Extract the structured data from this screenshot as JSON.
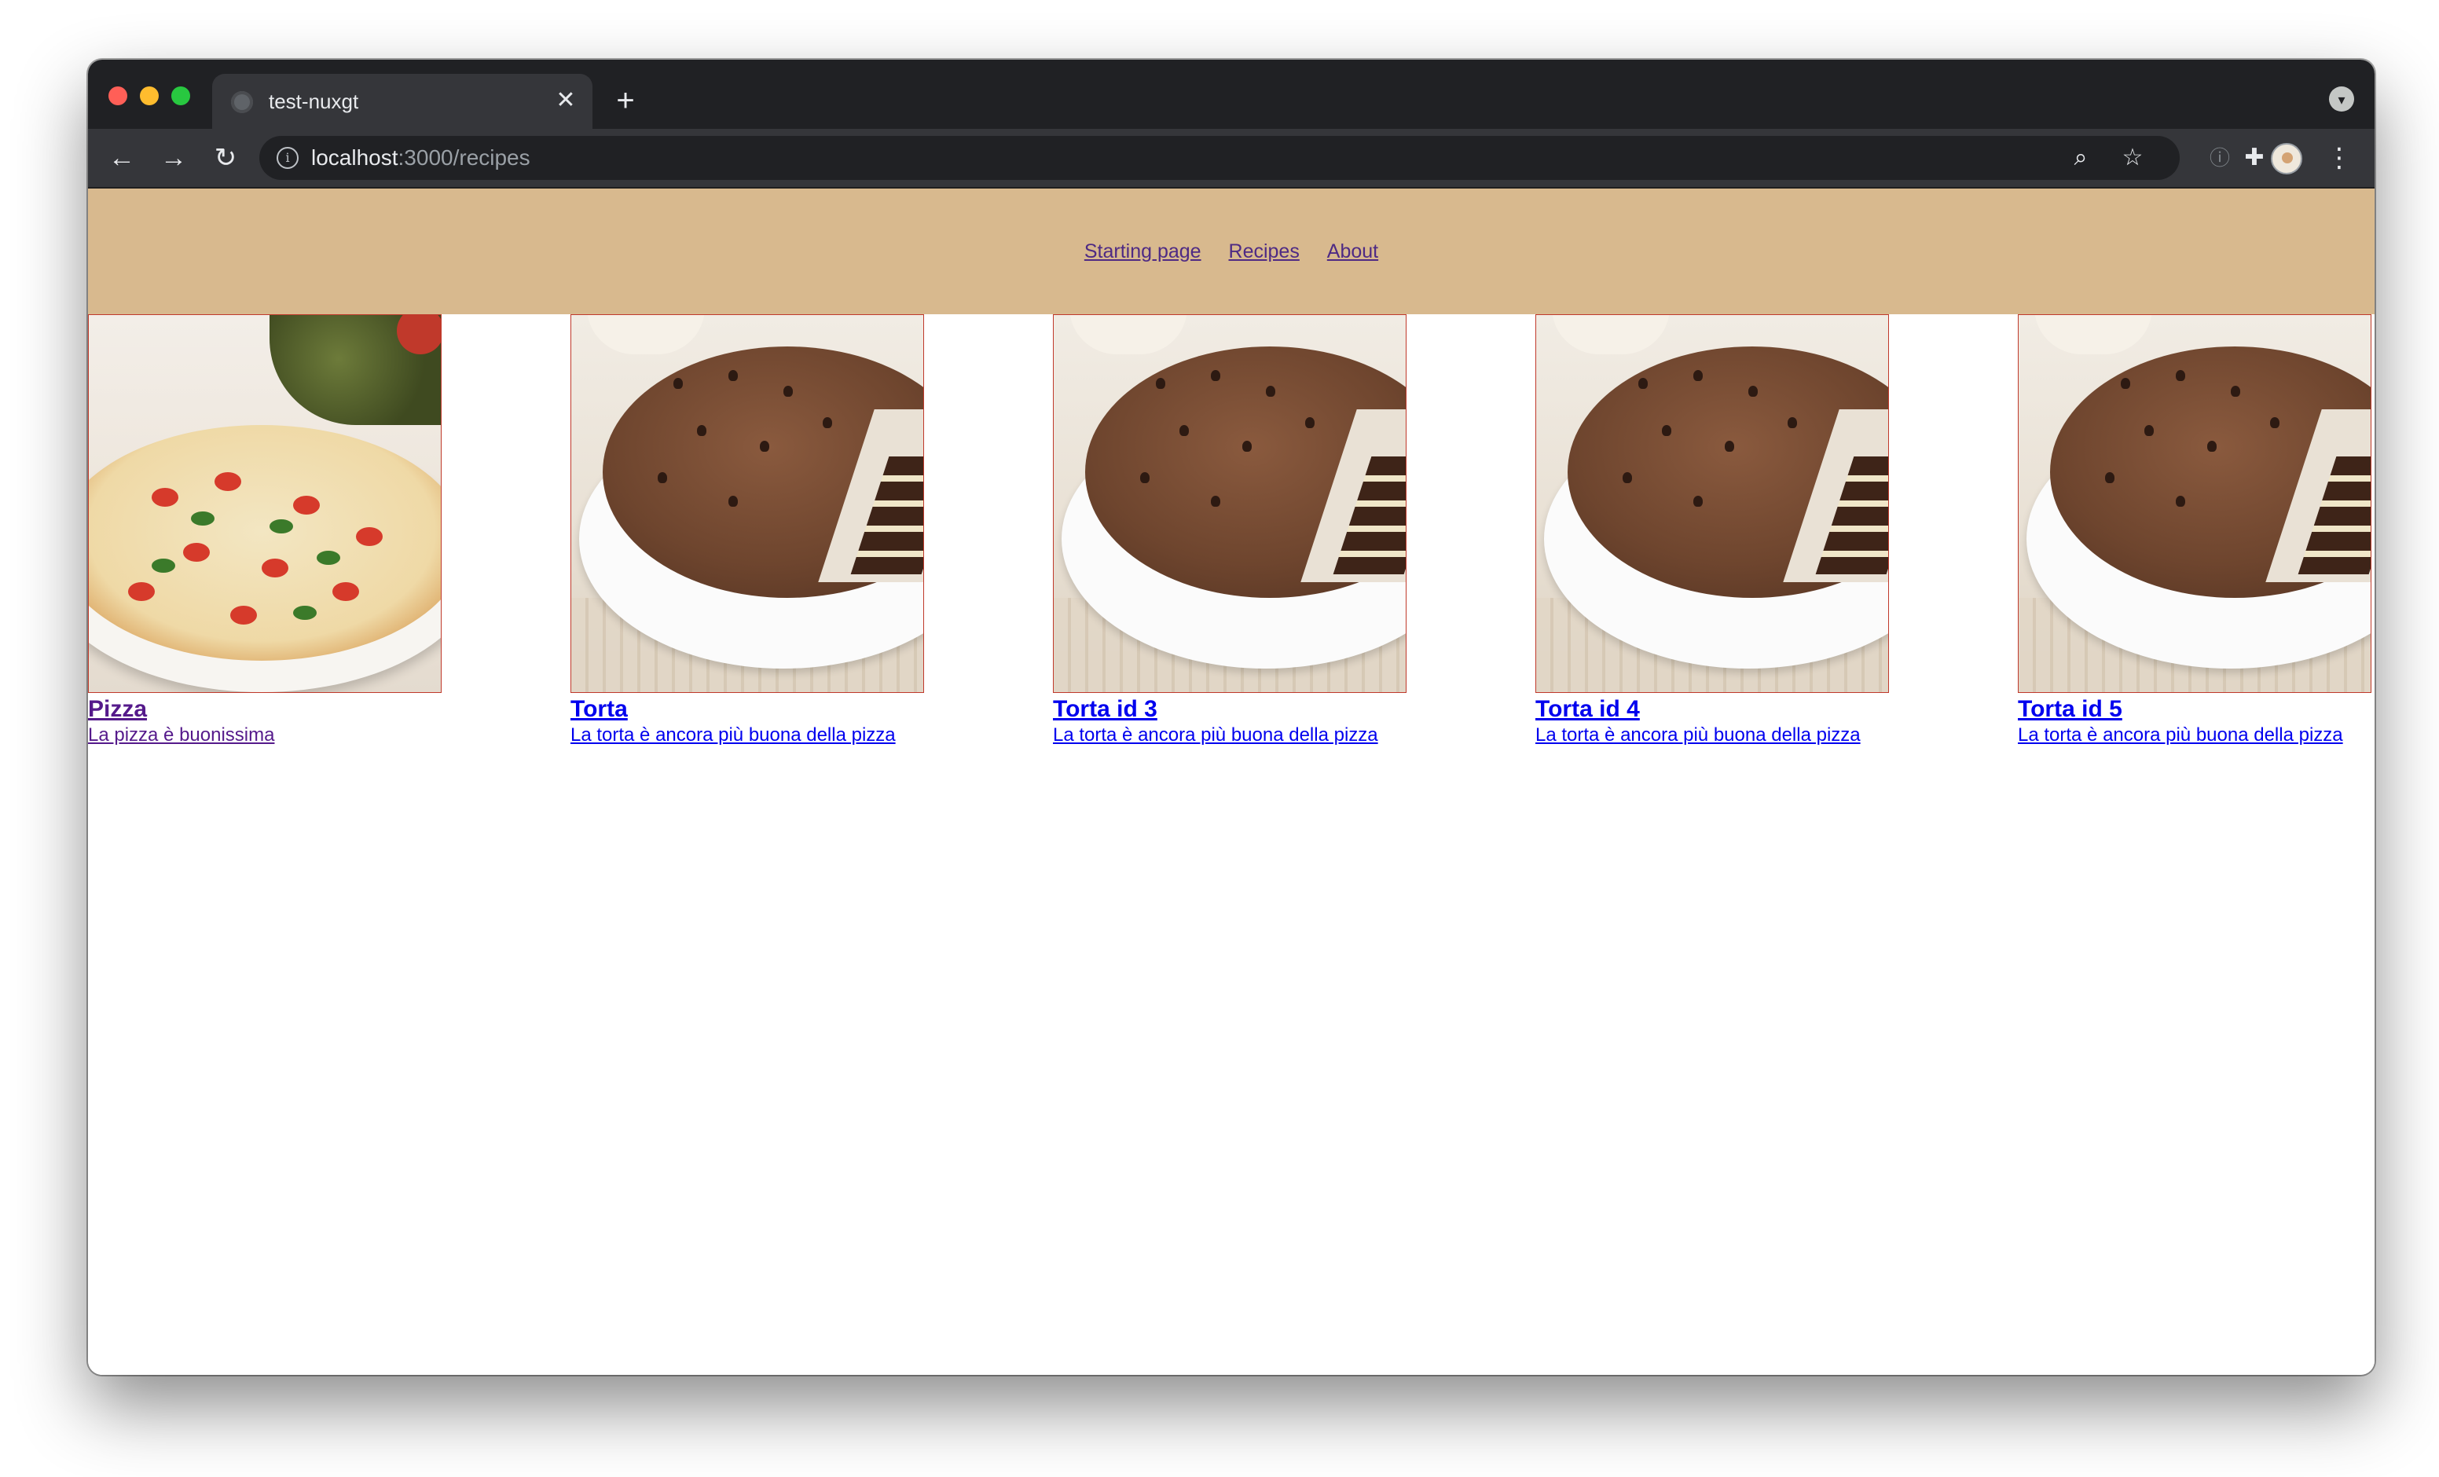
{
  "browser": {
    "tab_title": "test-nuxgt",
    "url_host": "localhost",
    "url_rest": ":3000/recipes"
  },
  "nav": {
    "links": [
      "Starting page",
      "Recipes",
      "About"
    ]
  },
  "recipes": [
    {
      "title": "Pizza",
      "description": "La pizza è buonissima",
      "image": "pizza",
      "visited": true
    },
    {
      "title": "Torta",
      "description": "La torta è ancora più buona della pizza",
      "image": "chocolate-cake",
      "visited": false
    },
    {
      "title": "Torta id 3",
      "description": "La torta è ancora più buona della pizza",
      "image": "chocolate-cake",
      "visited": false
    },
    {
      "title": "Torta id 4",
      "description": "La torta è ancora più buona della pizza",
      "image": "chocolate-cake",
      "visited": false
    },
    {
      "title": "Torta id 5",
      "description": "La torta è ancora più buona della pizza",
      "image": "chocolate-cake",
      "visited": false
    }
  ],
  "colors": {
    "header_bg": "#d8b98e",
    "card_border": "#c0392b",
    "link": "#0000ee",
    "visited_link": "#551a8b"
  }
}
